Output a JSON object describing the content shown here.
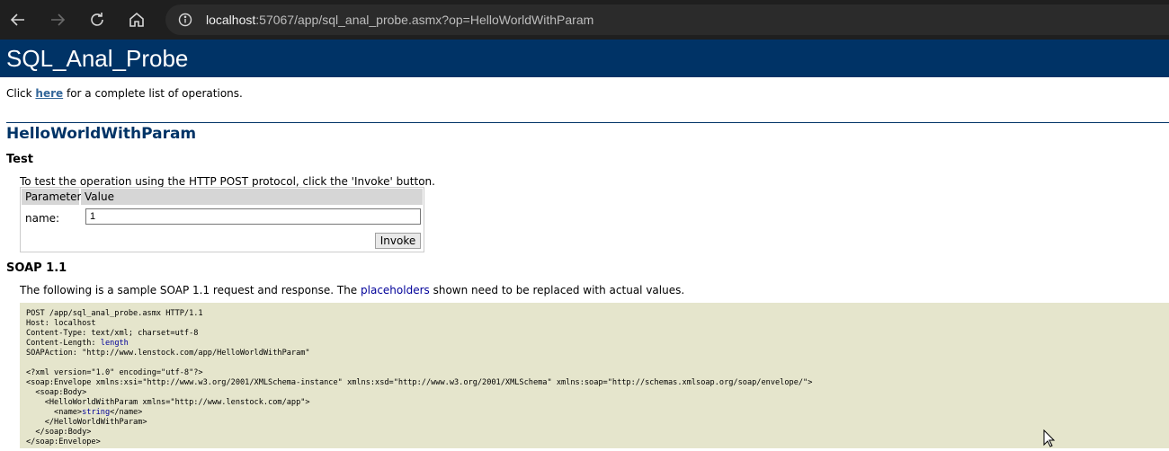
{
  "browser": {
    "url_host": "localhost",
    "url_rest": ":57067/app/sql_anal_probe.asmx?op=HelloWorldWithParam",
    "icons": [
      "back-icon",
      "forward-icon",
      "refresh-icon",
      "home-icon",
      "info-icon"
    ]
  },
  "page": {
    "service_title": "SQL_Anal_Probe",
    "intro_prefix": "Click ",
    "intro_link": "here",
    "intro_suffix": " for a complete list of operations.",
    "operation_title": "HelloWorldWithParam",
    "test_heading": "Test",
    "test_instructions": "To test the operation using the HTTP POST protocol, click the 'Invoke' button.",
    "param_table": {
      "col_parameter": "Parameter",
      "col_value": "Value",
      "param_label": "name:",
      "param_value": "1",
      "invoke_label": "Invoke"
    },
    "soap_heading": "SOAP 1.1",
    "soap_desc_prefix": "The following is a sample SOAP 1.1 request and response. The ",
    "soap_desc_placeholder": "placeholders",
    "soap_desc_suffix": " shown need to be replaced with actual values.",
    "sample": {
      "line1": "POST /app/sql_anal_probe.asmx HTTP/1.1",
      "line2": "Host: localhost",
      "line3": "Content-Type: text/xml; charset=utf-8",
      "line4_prefix": "Content-Length: ",
      "line4_placeholder": "length",
      "line5": "SOAPAction: \"http://www.lenstock.com/app/HelloWorldWithParam\"",
      "line7": "<?xml version=\"1.0\" encoding=\"utf-8\"?>",
      "line8": "<soap:Envelope xmlns:xsi=\"http://www.w3.org/2001/XMLSchema-instance\" xmlns:xsd=\"http://www.w3.org/2001/XMLSchema\" xmlns:soap=\"http://schemas.xmlsoap.org/soap/envelope/\">",
      "line9": "  <soap:Body>",
      "line10": "    <HelloWorldWithParam xmlns=\"http://www.lenstock.com/app\">",
      "line11_prefix": "      <name>",
      "line11_placeholder": "string",
      "line11_suffix": "</name>",
      "line12": "    </HelloWorldWithParam>",
      "line13": "  </soap:Body>",
      "line14": "</soap:Envelope>"
    }
  },
  "colors": {
    "banner": "#003366",
    "link": "#336699",
    "placeholder": "#000099",
    "sample_bg": "#e5e5cc"
  }
}
